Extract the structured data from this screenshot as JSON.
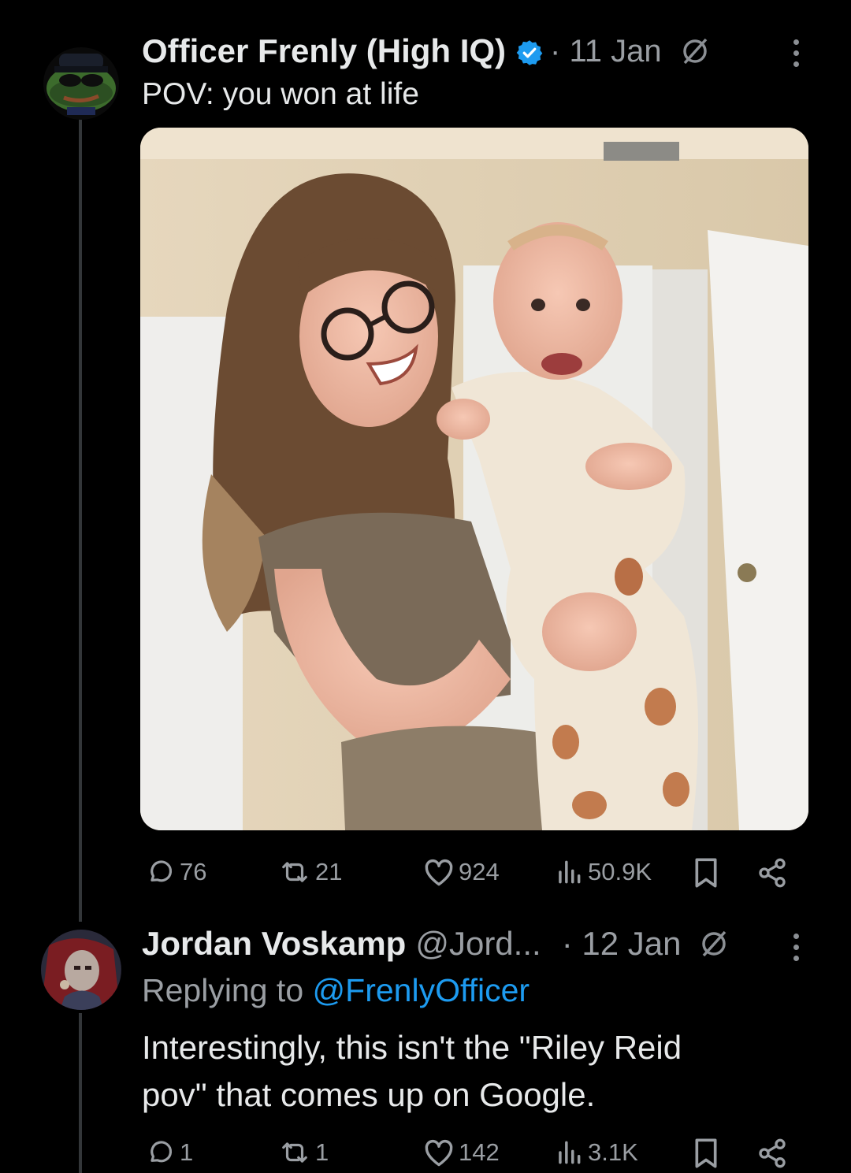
{
  "colors": {
    "background": "#000000",
    "text": "#e7e9ea",
    "muted": "#9a9ea3",
    "accent": "#1d9bf0",
    "thread_line": "#333639"
  },
  "posts": [
    {
      "author": "Officer Frenly (High IQ)",
      "verified": true,
      "date": "· 11 Jan",
      "text": "POV: you won at life",
      "media": "photo of smiling woman with glasses holding smiling baby in mushroom-print onesie",
      "stats": {
        "replies": "76",
        "reposts": "21",
        "likes": "924",
        "views": "50.9K"
      }
    },
    {
      "author": "Jordan Voskamp",
      "handle": "@Jord...",
      "date": "· 12 Jan",
      "replying_prefix": "Replying to",
      "replying_to": "@FrenlyOfficer",
      "text_line1": "Interestingly, this isn't the \"Riley Reid",
      "text_line2": "pov\" that comes up on Google.",
      "stats": {
        "replies": "1",
        "reposts": "1",
        "likes": "142",
        "views": "3.1K"
      }
    }
  ],
  "icons": [
    "verified-badge-icon",
    "grok-icon",
    "more-icon",
    "reply-icon",
    "repost-icon",
    "like-icon",
    "views-icon",
    "bookmark-icon",
    "share-icon"
  ]
}
